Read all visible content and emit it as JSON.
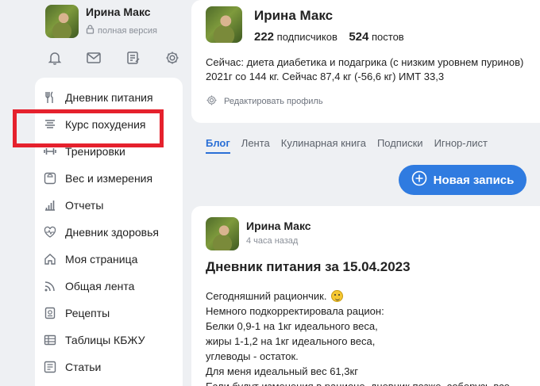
{
  "sidebar": {
    "user_name": "Ирина Макс",
    "version_label": "полная версия",
    "icons": [
      "bell-icon",
      "mail-icon",
      "notes-icon",
      "settings-icon"
    ],
    "menu": [
      {
        "label": "Дневник питания",
        "icon": "fork-knife-icon"
      },
      {
        "label": "Курс похудения",
        "icon": "course-icon"
      },
      {
        "label": "Тренировки",
        "icon": "dumbbell-icon"
      },
      {
        "label": "Вес и измерения",
        "icon": "scale-icon"
      },
      {
        "label": "Отчеты",
        "icon": "chart-icon"
      },
      {
        "label": "Дневник здоровья",
        "icon": "heart-pulse-icon"
      },
      {
        "label": "Моя страница",
        "icon": "home-icon"
      },
      {
        "label": "Общая лента",
        "icon": "rss-icon"
      },
      {
        "label": "Рецепты",
        "icon": "recipe-icon"
      },
      {
        "label": "Таблицы КБЖУ",
        "icon": "table-icon"
      },
      {
        "label": "Статьи",
        "icon": "article-icon"
      }
    ]
  },
  "profile": {
    "name": "Ирина Макс",
    "subscribers_count": "222",
    "subscribers_label": "подписчиков",
    "posts_count": "524",
    "posts_label": "постов",
    "status_line1": "Сейчас: диета диабетика и подагрика (с низким уровнем пуринов)",
    "status_line2": "2021г со 144 кг. Сейчас 87,4 кг (-56,6 кг) ИМТ 33,3",
    "edit_label": "Редактировать профиль"
  },
  "tabs": [
    {
      "label": "Блог",
      "active": true
    },
    {
      "label": "Лента",
      "active": false
    },
    {
      "label": "Кулинарная книга",
      "active": false
    },
    {
      "label": "Подписки",
      "active": false
    },
    {
      "label": "Игнор-лист",
      "active": false
    }
  ],
  "new_post_label": "Новая запись",
  "post": {
    "author": "Ирина Макс",
    "time": "4 часа назад",
    "title": "Дневник питания за 15.04.2023",
    "lines": [
      "Сегодняшний рациончик.",
      "Немного подкорректировала рацион:",
      "Белки 0,9-1 на 1кг идеального веса,",
      "жиры 1-1,2 на 1кг идеального веса,",
      "углеводы - остаток.",
      "Для меня идеальный вес 61,3кг",
      "Если будут изменения в рационе, дневник позже, соберусь все"
    ]
  },
  "colors": {
    "accent": "#2f7be0",
    "highlight": "#e5212d",
    "background": "#eef0f3"
  }
}
